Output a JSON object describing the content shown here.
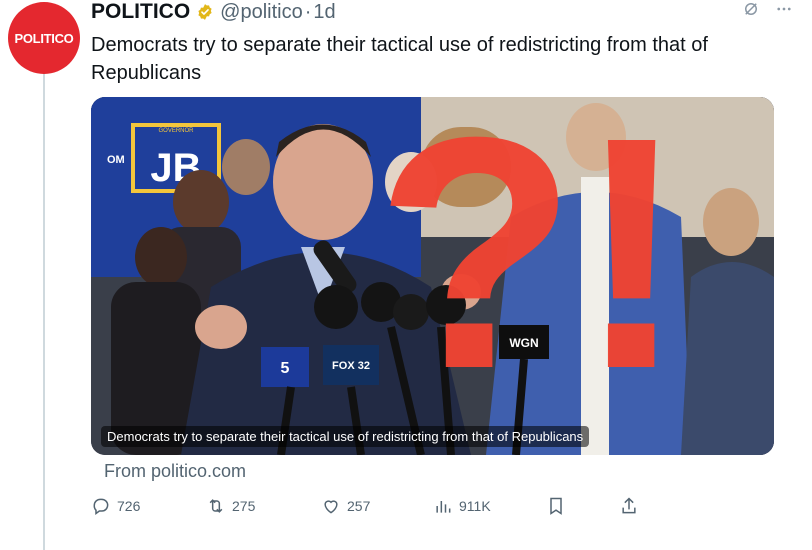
{
  "author": {
    "avatar_text": "POLITICO",
    "name": "POLITICO",
    "handle": "@politico",
    "separator": "·",
    "time": "1d"
  },
  "tweet": {
    "text": "Democrats try to separate their tactical use of redistricting from that of Republicans"
  },
  "media": {
    "caption": "Democrats try to separate their tactical use of redistricting from that of Republicans",
    "sign_text": "JB",
    "sign_small": "GOVERNOR",
    "sign_side": "OM",
    "mic_labels": [
      "5",
      "FOX 32",
      "WGN"
    ],
    "overlay_symbols": "?!"
  },
  "source": {
    "text": "From politico.com"
  },
  "actions": {
    "replies": "726",
    "reposts": "275",
    "likes": "257",
    "views": "911K"
  },
  "colors": {
    "brand_red": "#e4282f",
    "verified_gold": "#e2b719",
    "muted": "#536471",
    "overlay_red": "#ef4433"
  },
  "icons": {
    "top": [
      "grok-icon",
      "more-icon"
    ],
    "actions": [
      "reply-icon",
      "repost-icon",
      "like-icon",
      "views-icon",
      "bookmark-icon",
      "share-icon"
    ]
  }
}
